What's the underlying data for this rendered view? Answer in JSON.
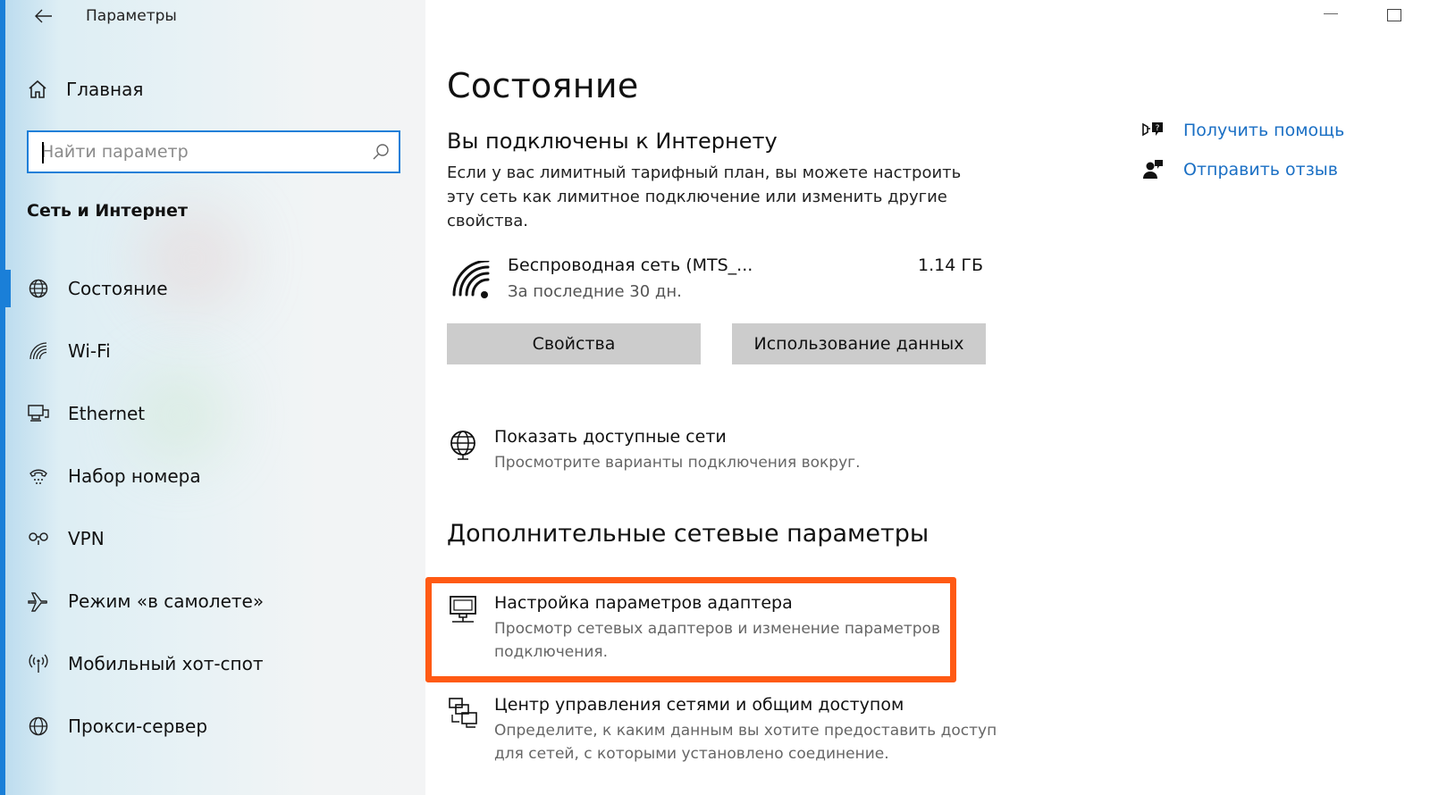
{
  "app": {
    "title": "Параметры"
  },
  "sidebar": {
    "home_label": "Главная",
    "search_placeholder": "Найти параметр",
    "section_title": "Сеть и Интернет",
    "items": [
      {
        "label": "Состояние",
        "icon": "globe-icon",
        "active": true
      },
      {
        "label": "Wi-Fi",
        "icon": "wifi-icon",
        "active": false
      },
      {
        "label": "Ethernet",
        "icon": "ethernet-icon",
        "active": false
      },
      {
        "label": "Набор номера",
        "icon": "dialup-icon",
        "active": false
      },
      {
        "label": "VPN",
        "icon": "vpn-icon",
        "active": false
      },
      {
        "label": "Режим «в самолете»",
        "icon": "airplane-icon",
        "active": false
      },
      {
        "label": "Мобильный хот-спот",
        "icon": "hotspot-icon",
        "active": false
      },
      {
        "label": "Прокси-сервер",
        "icon": "proxy-globe-icon",
        "active": false
      }
    ]
  },
  "main": {
    "title": "Состояние",
    "connection_title": "Вы подключены к Интернету",
    "connection_desc": "Если у вас лимитный тарифный план, вы можете настроить эту сеть как лимитное подключение или изменить другие свойства.",
    "network": {
      "name": "Беспроводная сеть (MTS_...",
      "period": "За последние 30 дн.",
      "usage": "1.14 ГБ"
    },
    "buttons": {
      "properties": "Свойства",
      "data_usage": "Использование данных"
    },
    "show_networks": {
      "title": "Показать доступные сети",
      "desc": "Просмотрите варианты подключения вокруг."
    },
    "advanced_title": "Дополнительные сетевые параметры",
    "adapter": {
      "title": "Настройка параметров адаптера",
      "desc": "Просмотр сетевых адаптеров и изменение параметров подключения."
    },
    "sharing_center": {
      "title": "Центр управления сетями и общим доступом",
      "desc": "Определите, к каким данным вы хотите предоставить доступ для сетей, с которыми установлено соединение."
    }
  },
  "help": {
    "get_help": "Получить помощь",
    "feedback": "Отправить отзыв"
  },
  "colors": {
    "accent": "#1a7fd8",
    "link": "#1a6fc4",
    "highlight": "#ff5a14",
    "button": "#cccccc"
  }
}
